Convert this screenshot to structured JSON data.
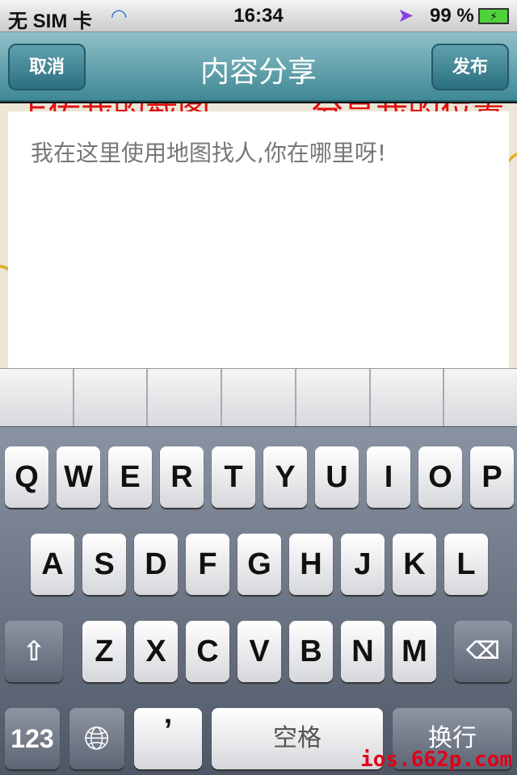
{
  "status": {
    "carrier": "无 SIM 卡",
    "time": "16:34",
    "battery": "99 %",
    "icons": [
      "wifi-icon",
      "location-arrow-icon",
      "battery-charging-icon"
    ]
  },
  "nav": {
    "title": "内容分享",
    "cancel": "取消",
    "publish": "发布"
  },
  "map": {
    "label_left": "上传我的截图",
    "label_right": "分享我的位置"
  },
  "textbox": {
    "value": "我在这里使用地图找人,你在哪里呀!"
  },
  "keyboard": {
    "row1": [
      "Q",
      "W",
      "E",
      "R",
      "T",
      "Y",
      "U",
      "I",
      "O",
      "P"
    ],
    "row2": [
      "A",
      "S",
      "D",
      "F",
      "G",
      "H",
      "J",
      "K",
      "L"
    ],
    "row3": [
      "Z",
      "X",
      "C",
      "V",
      "B",
      "N",
      "M"
    ],
    "numbers": "123",
    "comma": "’",
    "space": "空格",
    "return": "换行"
  },
  "watermark": "ios.662p.com"
}
